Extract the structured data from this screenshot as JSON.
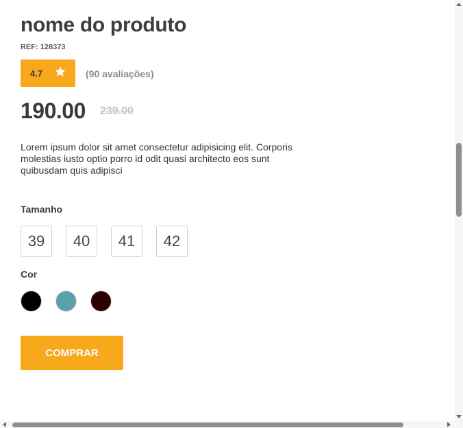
{
  "product": {
    "name": "nome do produto",
    "ref": "REF: 128373",
    "rating": "4.7",
    "reviews": "(90 avaliações)",
    "price": "190.00",
    "old_price": "239.00",
    "description": "Lorem ipsum dolor sit amet consectetur adipisicing elit. Corporis molestias iusto optio porro id odit quasi architecto eos sunt quibusdam quis adipisci"
  },
  "size": {
    "label": "Tamanho",
    "options": [
      "39",
      "40",
      "41",
      "42"
    ]
  },
  "color": {
    "label": "Cor",
    "options": [
      "#000000",
      "#5aa1ab",
      "#2b0000"
    ]
  },
  "buy_button": {
    "label": "COMPRAR"
  },
  "theme": {
    "accent": "#f7a81b"
  },
  "icons": {
    "rating": "star-icon"
  }
}
